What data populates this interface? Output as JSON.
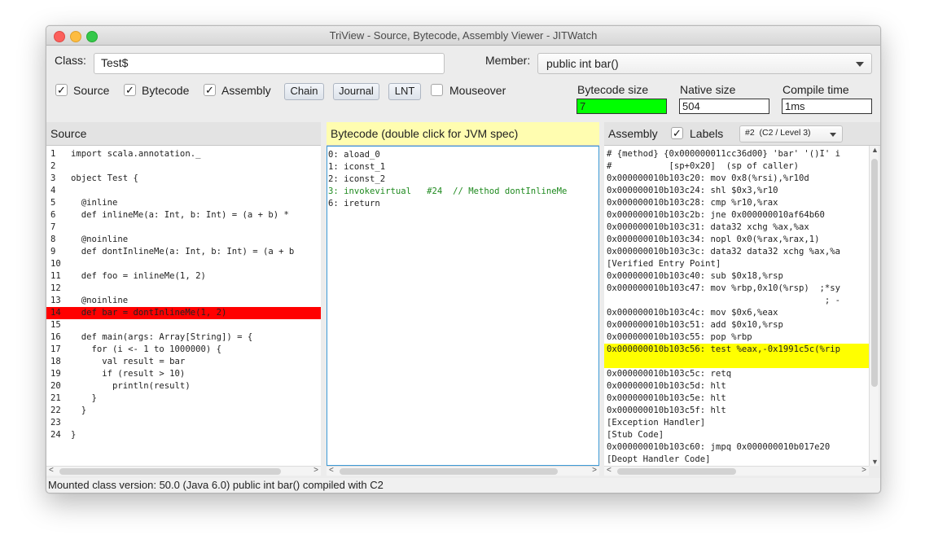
{
  "window": {
    "title": "TriView - Source, Bytecode, Assembly Viewer - JITWatch"
  },
  "class_label": "Class:",
  "class_value": "Test$",
  "member_label": "Member:",
  "member_value": "public int bar()",
  "checks": {
    "source": {
      "label": "Source",
      "checked": true
    },
    "bytecode": {
      "label": "Bytecode",
      "checked": true
    },
    "assembly": {
      "label": "Assembly",
      "checked": true
    },
    "mouseover": {
      "label": "Mouseover",
      "checked": false
    }
  },
  "buttons": {
    "chain": "Chain",
    "journal": "Journal",
    "lnt": "LNT"
  },
  "stats": {
    "bytecode_size": {
      "label": "Bytecode size",
      "value": "7",
      "color": "#00ff00"
    },
    "native_size": {
      "label": "Native size",
      "value": "504"
    },
    "compile_time": {
      "label": "Compile time",
      "value": "1ms"
    }
  },
  "source_pane": {
    "header": "Source",
    "highlight_color": "#ff0000",
    "lines": [
      {
        "n": "1",
        "t": "import scala.annotation._"
      },
      {
        "n": "2",
        "t": ""
      },
      {
        "n": "3",
        "t": "object Test {"
      },
      {
        "n": "4",
        "t": ""
      },
      {
        "n": "5",
        "t": "  @inline"
      },
      {
        "n": "6",
        "t": "  def inlineMe(a: Int, b: Int) = (a + b) *"
      },
      {
        "n": "7",
        "t": ""
      },
      {
        "n": "8",
        "t": "  @noinline"
      },
      {
        "n": "9",
        "t": "  def dontInlineMe(a: Int, b: Int) = (a + b"
      },
      {
        "n": "10",
        "t": ""
      },
      {
        "n": "11",
        "t": "  def foo = inlineMe(1, 2)"
      },
      {
        "n": "12",
        "t": ""
      },
      {
        "n": "13",
        "t": "  @noinline"
      },
      {
        "n": "14",
        "t": "  def bar = dontInlineMe(1, 2)",
        "hl": true
      },
      {
        "n": "15",
        "t": ""
      },
      {
        "n": "16",
        "t": "  def main(args: Array[String]) = {"
      },
      {
        "n": "17",
        "t": "    for (i <- 1 to 1000000) {"
      },
      {
        "n": "18",
        "t": "      val result = bar"
      },
      {
        "n": "19",
        "t": "      if (result > 10)"
      },
      {
        "n": "20",
        "t": "        println(result)"
      },
      {
        "n": "21",
        "t": "    }"
      },
      {
        "n": "22",
        "t": "  }"
      },
      {
        "n": "23",
        "t": ""
      },
      {
        "n": "24",
        "t": "}"
      }
    ]
  },
  "bytecode_pane": {
    "header": "Bytecode (double click for JVM spec)",
    "header_color": "#fffdb0",
    "lines": [
      {
        "t": "0: aload_0"
      },
      {
        "t": "1: iconst_1"
      },
      {
        "t": "2: iconst_2"
      },
      {
        "t": "3: invokevirtual   #24  // Method dontInlineMe",
        "c": "green"
      },
      {
        "t": "6: ireturn"
      }
    ]
  },
  "assembly_pane": {
    "header": "Assembly",
    "labels_label": "Labels",
    "labels_checked": true,
    "level_value": "#2  (C2 / Level 3)",
    "highlight_color": "#ffff00",
    "lines": [
      {
        "t": "# {method} {0x000000011cc36d00} 'bar' '()I' i"
      },
      {
        "t": "#           [sp+0x20]  (sp of caller)"
      },
      {
        "t": "0x000000010b103c20: mov 0x8(%rsi),%r10d"
      },
      {
        "t": "0x000000010b103c24: shl $0x3,%r10"
      },
      {
        "t": "0x000000010b103c28: cmp %r10,%rax"
      },
      {
        "t": "0x000000010b103c2b: jne 0x000000010af64b60"
      },
      {
        "t": "0x000000010b103c31: data32 xchg %ax,%ax"
      },
      {
        "t": "0x000000010b103c34: nopl 0x0(%rax,%rax,1)"
      },
      {
        "t": "0x000000010b103c3c: data32 data32 xchg %ax,%a"
      },
      {
        "t": "[Verified Entry Point]"
      },
      {
        "t": "0x000000010b103c40: sub $0x18,%rsp"
      },
      {
        "t": "0x000000010b103c47: mov %rbp,0x10(%rsp)  ;*sy"
      },
      {
        "t": "                                          ; -"
      },
      {
        "t": "0x000000010b103c4c: mov $0x6,%eax"
      },
      {
        "t": "0x000000010b103c51: add $0x10,%rsp"
      },
      {
        "t": "0x000000010b103c55: pop %rbp"
      },
      {
        "t": "0x000000010b103c56: test %eax,-0x1991c5c(%rip",
        "hl": true
      },
      {
        "t": "",
        "hl": true
      },
      {
        "t": "0x000000010b103c5c: retq"
      },
      {
        "t": "0x000000010b103c5d: hlt"
      },
      {
        "t": "0x000000010b103c5e: hlt"
      },
      {
        "t": "0x000000010b103c5f: hlt"
      },
      {
        "t": "[Exception Handler]"
      },
      {
        "t": "[Stub Code]"
      },
      {
        "t": "0x000000010b103c60: jmpq 0x000000010b017e20"
      },
      {
        "t": "[Deopt Handler Code]"
      }
    ]
  },
  "status": "Mounted class version: 50.0 (Java 6.0) public int bar() compiled with C2"
}
